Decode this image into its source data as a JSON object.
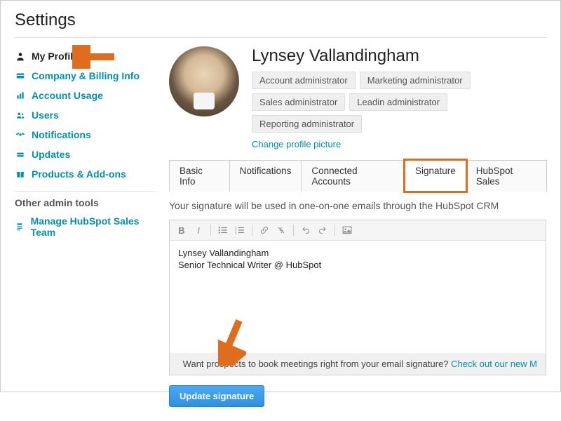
{
  "header": {
    "title": "Settings"
  },
  "sidebar": {
    "items": [
      {
        "label": "My Profile",
        "icon": "user",
        "active": true
      },
      {
        "label": "Company & Billing Info",
        "icon": "card"
      },
      {
        "label": "Account Usage",
        "icon": "bars"
      },
      {
        "label": "Users",
        "icon": "group"
      },
      {
        "label": "Notifications",
        "icon": "signal"
      },
      {
        "label": "Updates",
        "icon": "inbox"
      },
      {
        "label": "Products & Add-ons",
        "icon": "gift"
      }
    ],
    "section_header": "Other admin tools",
    "admin_items": [
      {
        "label": "Manage HubSpot Sales Team",
        "icon": "profile"
      }
    ]
  },
  "profile": {
    "name": "Lynsey Vallandingham",
    "badges": [
      "Account administrator",
      "Marketing administrator",
      "Sales administrator",
      "Leadin administrator",
      "Reporting administrator"
    ],
    "change_link": "Change profile picture"
  },
  "tabs": {
    "items": [
      "Basic Info",
      "Notifications",
      "Connected Accounts",
      "Signature",
      "HubSpot Sales"
    ],
    "highlighted_index": 3
  },
  "signature": {
    "description": "Your signature will be used in one-on-one emails through the HubSpot CRM",
    "body_line1": "Lynsey Vallandingham",
    "body_line2": "Senior Technical Writer @ HubSpot",
    "footer_text": "Want prospects to book meetings right from your email signature? ",
    "footer_link": "Check out our new M",
    "button_label": "Update signature"
  },
  "annotations": {
    "arrow_color": "#e06d1e"
  }
}
